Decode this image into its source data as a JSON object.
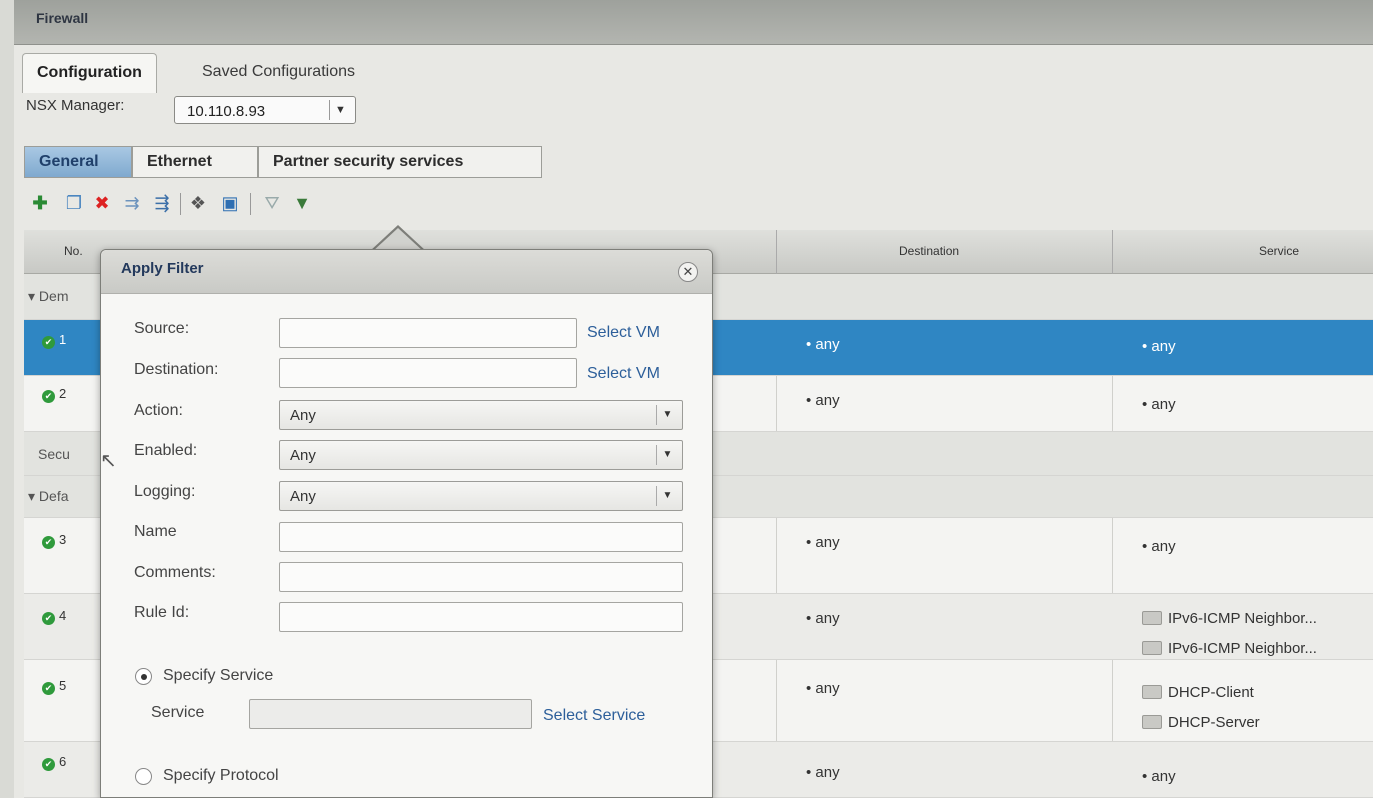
{
  "window": {
    "title": "Firewall"
  },
  "top_tabs": [
    {
      "label": "Configuration",
      "active": true
    },
    {
      "label": "Saved Configurations",
      "active": false
    }
  ],
  "manager": {
    "label": "NSX Manager:",
    "value": "10.110.8.93"
  },
  "sub_tabs": [
    {
      "label": "General",
      "active": true
    },
    {
      "label": "Ethernet",
      "active": false
    },
    {
      "label": "Partner security services",
      "active": false
    }
  ],
  "grid": {
    "headers": {
      "no": "No.",
      "destination": "Destination",
      "service": "Service"
    },
    "groups": {
      "demo": "Dem",
      "security": "Secu",
      "default": "Defa"
    },
    "rows": [
      {
        "num": "1",
        "destination": "any",
        "service": [
          "any"
        ]
      },
      {
        "num": "2",
        "destination": "any",
        "service": [
          "any"
        ]
      },
      {
        "num": "3",
        "destination": "any",
        "service": [
          "any"
        ]
      },
      {
        "num": "4",
        "destination": "any",
        "service": [
          "IPv6-ICMP Neighbor...",
          "IPv6-ICMP Neighbor..."
        ]
      },
      {
        "num": "5",
        "destination": "any",
        "service": [
          "DHCP-Client",
          "DHCP-Server"
        ]
      },
      {
        "num": "6",
        "destination": "any",
        "service": [
          "any"
        ]
      }
    ]
  },
  "filter_dialog": {
    "title": "Apply Filter",
    "source_label": "Source:",
    "destination_label": "Destination:",
    "select_vm": "Select VM",
    "action_label": "Action:",
    "action_value": "Any",
    "enabled_label": "Enabled:",
    "enabled_value": "Any",
    "logging_label": "Logging:",
    "logging_value": "Any",
    "name_label": "Name",
    "comments_label": "Comments:",
    "rule_id_label": "Rule Id:",
    "specify_service": "Specify Service",
    "service_label": "Service",
    "select_service": "Select Service",
    "specify_protocol": "Specify Protocol"
  }
}
